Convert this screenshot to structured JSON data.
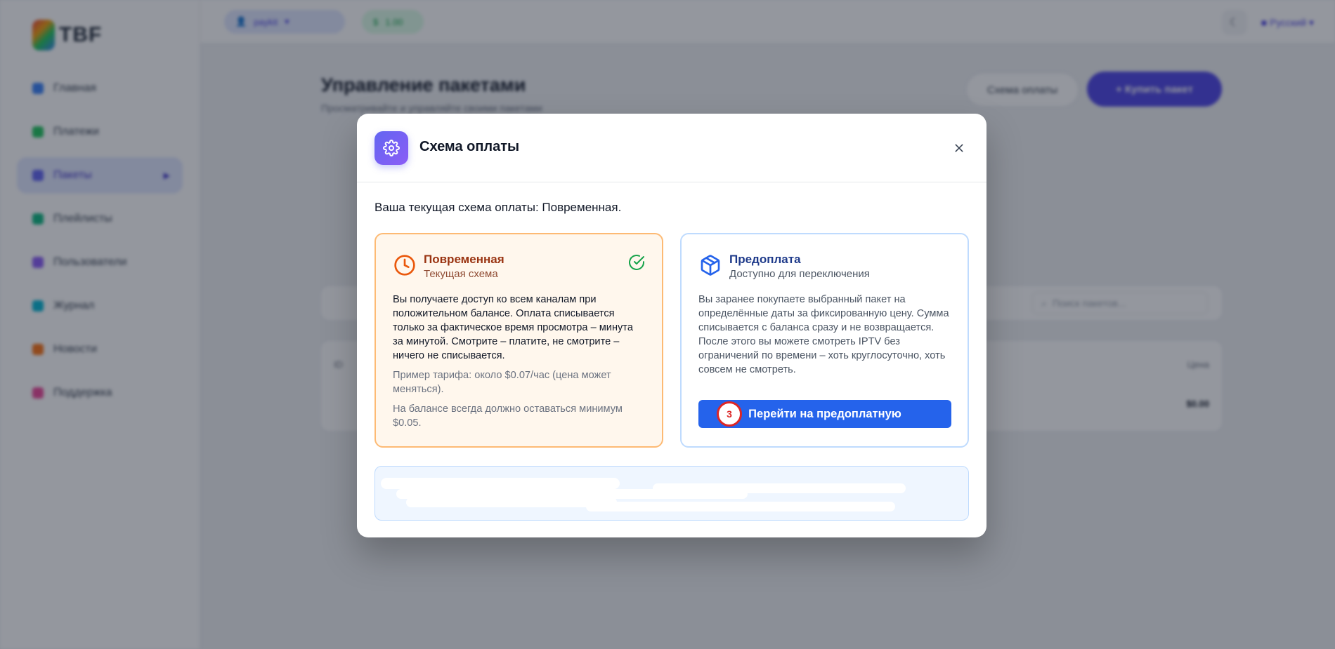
{
  "background": {
    "logo_text": "TBF",
    "nav": [
      {
        "label": "Главная",
        "color": "#3b82f6"
      },
      {
        "label": "Платежи",
        "color": "#22c55e"
      },
      {
        "label": "Пакеты",
        "color": "#6366f1"
      },
      {
        "label": "Плейлисты",
        "color": "#10b981"
      },
      {
        "label": "Пользователи",
        "color": "#8b5cf6"
      },
      {
        "label": "Журнал",
        "color": "#06b6d4"
      },
      {
        "label": "Новости",
        "color": "#f97316"
      },
      {
        "label": "Поддержка",
        "color": "#ec4899"
      }
    ],
    "user_pill": "paykit",
    "balance_pill": "1.00",
    "language": "Русский",
    "page_title": "Управление пакетами",
    "page_subtitle": "Просматривайте и управляйте своими пакетами",
    "scheme_button": "Схема оплаты",
    "buy_button": "+ Купить пакет",
    "search_placeholder": "Поиск пакетов...",
    "table_col_id": "ID",
    "table_col_price": "Цена",
    "table_price_value": "$0.00"
  },
  "modal": {
    "title": "Схема оплаты",
    "current_scheme_text": "Ваша текущая схема оплаты: Повременная.",
    "plans": {
      "timebased": {
        "name": "Повременная",
        "status": "Текущая схема",
        "description": "Вы получаете доступ ко всем каналам при положительном балансе. Оплата списывается только за фактическое время просмотра – минута за минутой. Смотрите – платите, не смотрите – ничего не списывается.",
        "example": "Пример тарифа: около $0.07/час (цена может меняться).",
        "minimum": "На балансе всегда должно оставаться минимум $0.05."
      },
      "prepaid": {
        "name": "Предоплата",
        "status": "Доступно для переключения",
        "description": "Вы заранее покупаете выбранный пакет на определённые даты за фиксированную цену. Сумма списывается с баланса сразу и не возвращается. После этого вы можете смотреть IPTV без ограничений по времени – хоть круглосуточно, хоть совсем не смотреть.",
        "switch_button": "Перейти на предоплатную",
        "step_badge": "3"
      }
    }
  },
  "colors": {
    "accent_indigo": "#6366f1",
    "primary_blue": "#2563eb",
    "orange_border": "#fdba74",
    "blue_border": "#bfdbfe",
    "badge_red": "#dc2626"
  },
  "icons": {
    "header": "gear-icon",
    "timebased": "clock-icon",
    "prepaid": "package-icon",
    "current": "check-circle-icon",
    "close": "close-icon"
  }
}
